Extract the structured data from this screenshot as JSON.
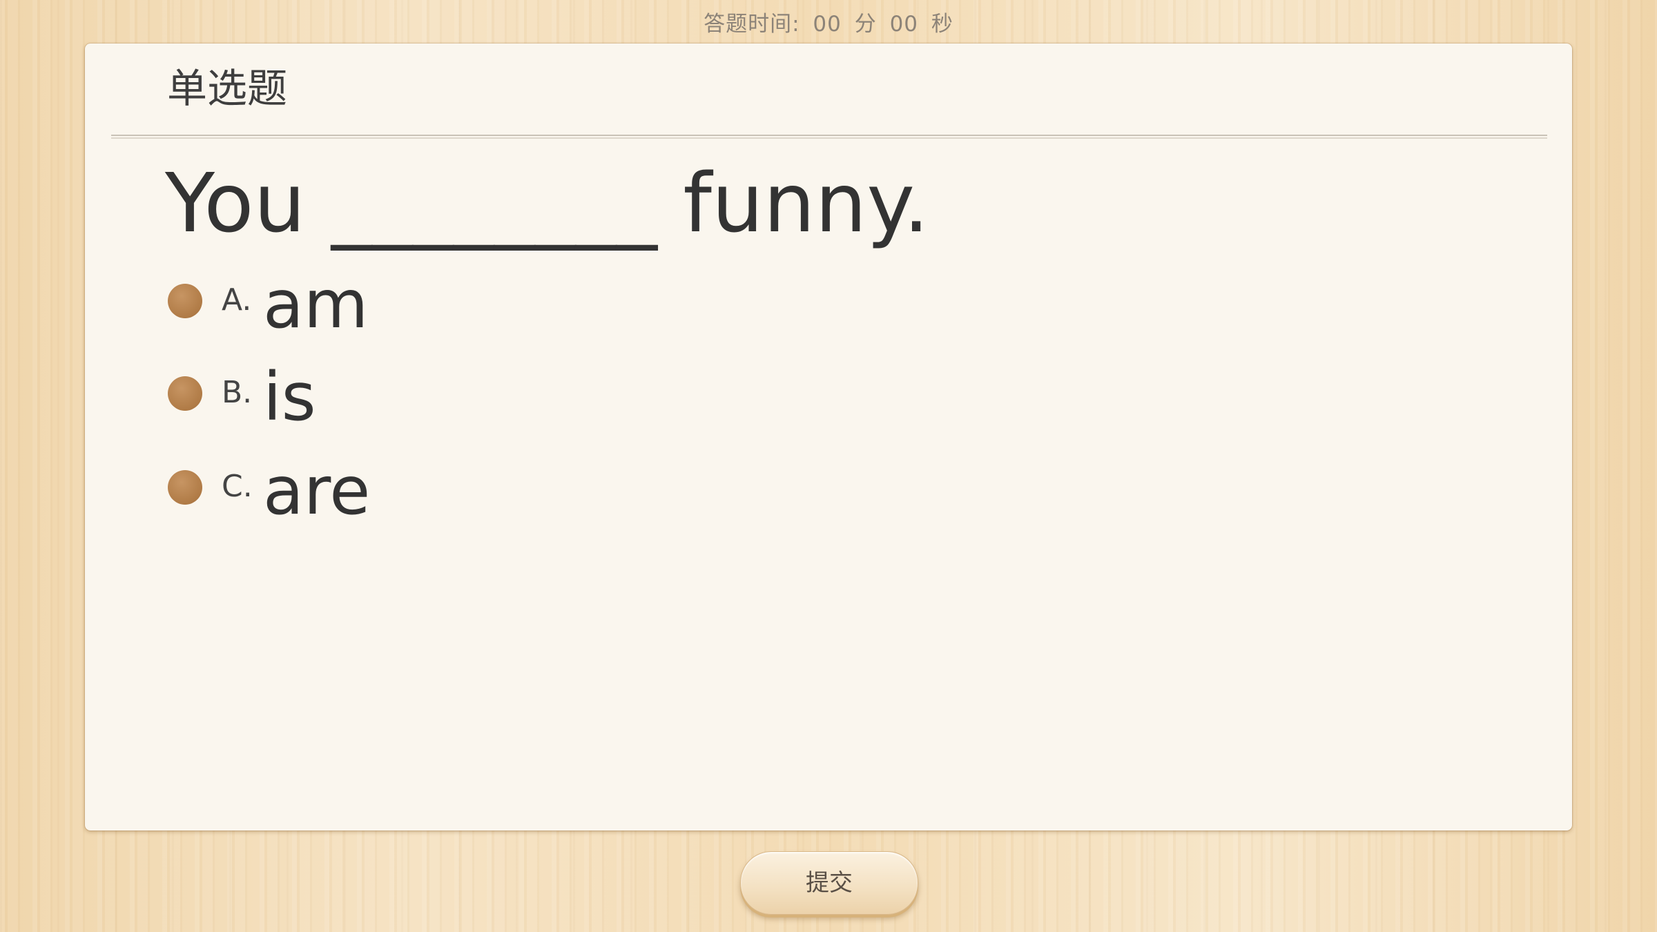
{
  "timer": {
    "label": "答题时间:",
    "minutes": "00",
    "minutes_unit": "分",
    "seconds": "00",
    "seconds_unit": "秒"
  },
  "card": {
    "title": "单选题",
    "question": "You ________ funny."
  },
  "options": [
    {
      "letter": "A.",
      "text": "am"
    },
    {
      "letter": "B.",
      "text": "is"
    },
    {
      "letter": "C.",
      "text": "are"
    }
  ],
  "submit": {
    "label": "提交"
  },
  "colors": {
    "radio": "#b07b46",
    "card_background": "#faf6ee",
    "text": "#333333"
  }
}
